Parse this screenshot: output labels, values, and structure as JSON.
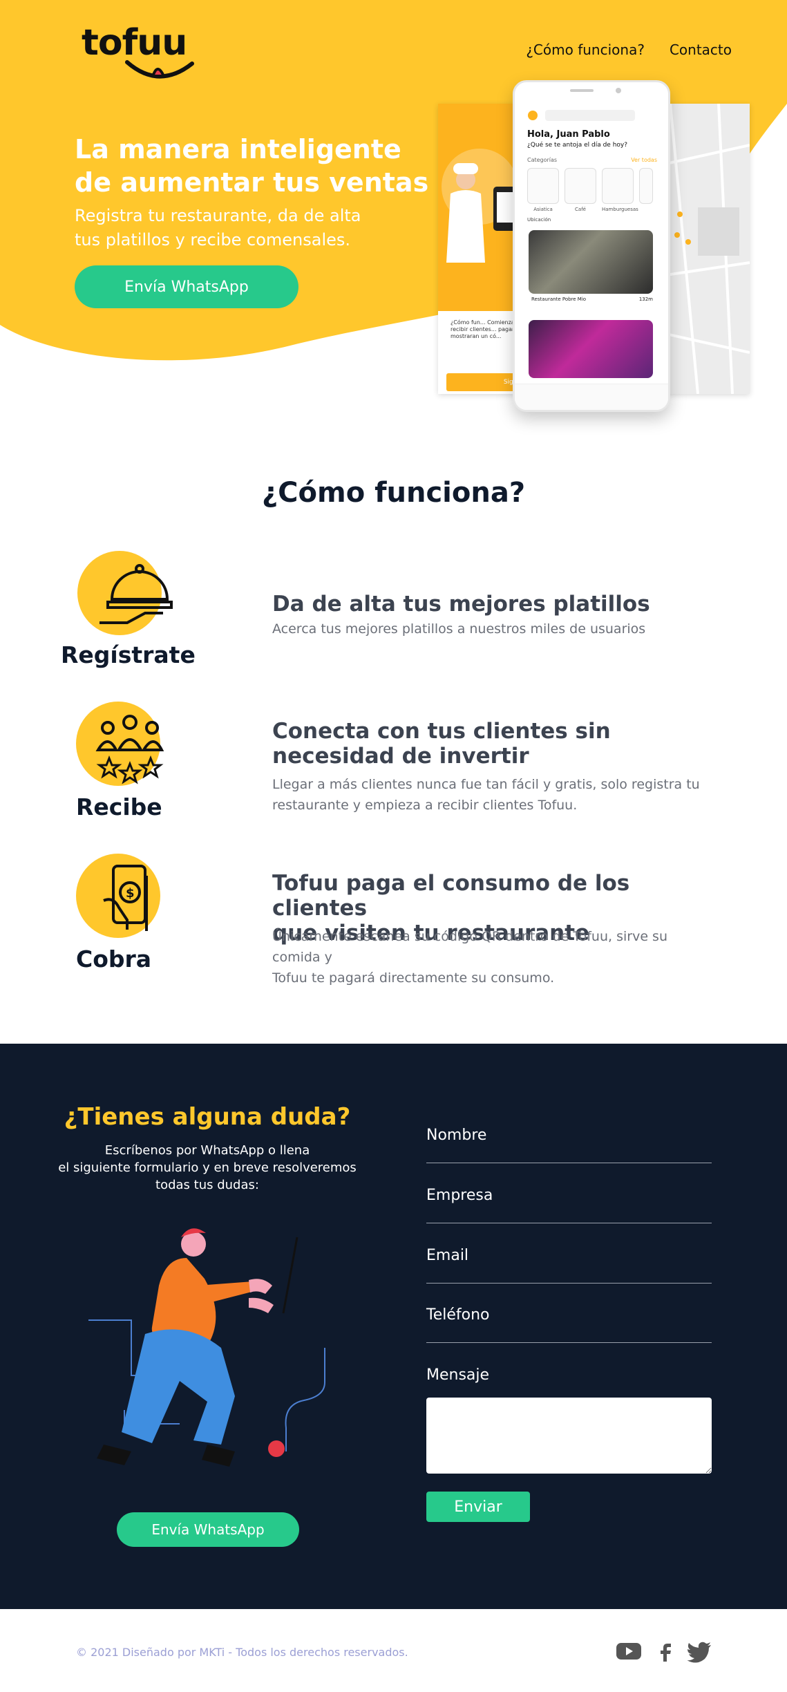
{
  "brand": {
    "logo_text": "tofuu"
  },
  "nav": {
    "items": [
      "¿Cómo funciona?",
      "Contacto"
    ]
  },
  "hero": {
    "title_line1": "La manera inteligente",
    "title_line2": "de aumentar tus ventas",
    "subtitle_line1": "Registra tu restaurante, da de alta",
    "subtitle_line2": "tus platillos y recibe comensales.",
    "cta": "Envía WhatsApp"
  },
  "phone": {
    "greeting": "Hola, Juan Pablo",
    "question": "¿Qué se te antoja el día de hoy?",
    "categories_label": "Categorías",
    "see_all": "Ver todas",
    "categories": [
      "Asiatica",
      "Café",
      "Hamburguesas"
    ],
    "location": "Ubicación",
    "restaurant": "Restaurante Pobre Mio",
    "distance": "132m"
  },
  "mock_left": {
    "text": "¿Cómo fun... Comienza a recibir clientes... pagar te mostraran un có...",
    "cta": "Sigue"
  },
  "how": {
    "title": "¿Cómo funciona?",
    "steps": [
      {
        "label": "Regístrate",
        "title_line1": "Da de alta tus mejores platillos",
        "title_line2": "",
        "desc_line1": "Acerca tus mejores platillos a nuestros miles de usuarios",
        "desc_line2": "",
        "icon": "serving-tray-icon"
      },
      {
        "label": "Recibe",
        "title_line1": "Conecta con tus  clientes sin",
        "title_line2": "necesidad de invertir",
        "desc_line1": "Llegar a más clientes nunca fue tan fácil y gratis, solo registra tu",
        "desc_line2": "restaurante y empieza a recibir clientes Tofuu.",
        "icon": "customers-rating-icon"
      },
      {
        "label": "Cobra",
        "title_line1": "Tofuu paga el consumo de los clientes",
        "title_line2": "que visiten tu restaurante",
        "desc_line1": "Únicamente escanea su código QR dentro de Tofuu, sirve su comida y",
        "desc_line2": "Tofuu te pagará directamente su consumo.",
        "icon": "phone-payment-icon"
      }
    ]
  },
  "contact": {
    "title": "¿Tienes alguna duda?",
    "sub_line1": "Escríbenos por WhatsApp o llena",
    "sub_line2": "el siguiente formulario y en breve resolveremos",
    "sub_line3": "todas tus dudas:",
    "cta": "Envía WhatsApp",
    "fields": [
      "Nombre",
      "Empresa",
      "Email",
      "Teléfono",
      "Mensaje"
    ],
    "send": "Enviar"
  },
  "footer": {
    "copyright": "© 2021 Diseñado por MKTi - Todos los derechos reservados.",
    "social": [
      "youtube-icon",
      "facebook-icon",
      "twitter-icon"
    ]
  },
  "colors": {
    "yellow": "#ffc72c",
    "navy": "#0f1a2c",
    "green": "#27c98b",
    "orange": "#fdb31e"
  }
}
